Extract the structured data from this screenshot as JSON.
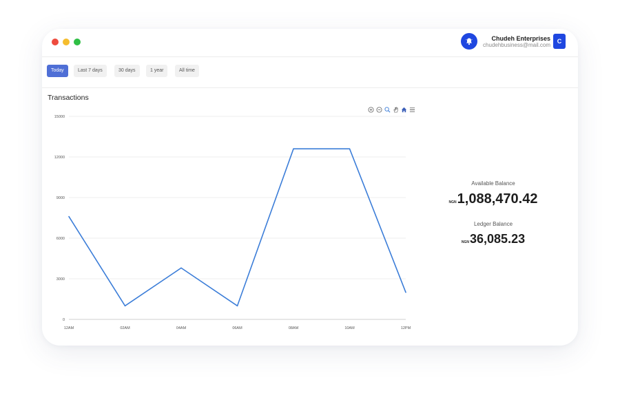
{
  "header": {
    "user_name": "Chudeh Enterprises",
    "user_email": "chudehbusiness@mail.com",
    "avatar_letter": "C",
    "accent_color": "#1f47e0"
  },
  "filters": [
    {
      "label": "Today",
      "active": true
    },
    {
      "label": "Last 7 days",
      "active": false
    },
    {
      "label": "30 days",
      "active": false
    },
    {
      "label": "1 year",
      "active": false
    },
    {
      "label": "All time",
      "active": false
    }
  ],
  "chart_toolbar": [
    "zoom-in-icon",
    "zoom-out-icon",
    "magnifier-icon",
    "pan-hand-icon",
    "home-icon",
    "menu-icon"
  ],
  "chart_data": {
    "type": "line",
    "title": "Transactions",
    "categories": [
      "12AM",
      "02AM",
      "04AM",
      "06AM",
      "08AM",
      "10AM",
      "12PM"
    ],
    "x": [
      0,
      1,
      2,
      3,
      4,
      5,
      6
    ],
    "series": [
      {
        "values": [
          7600,
          1000,
          3800,
          1000,
          12600,
          12600,
          2000
        ],
        "color": "#3b7dd8"
      }
    ],
    "yticks": [
      "0",
      "3000",
      "6000",
      "9000",
      "12000",
      "15000"
    ],
    "ylim": [
      0,
      15000
    ],
    "grid": true
  },
  "balances": {
    "available_label": "Available Balance",
    "available_currency": "NGN",
    "available_amount": "1,088,470.42",
    "ledger_label": "Ledger Balance",
    "ledger_currency": "NGN",
    "ledger_amount": "36,085.23"
  }
}
